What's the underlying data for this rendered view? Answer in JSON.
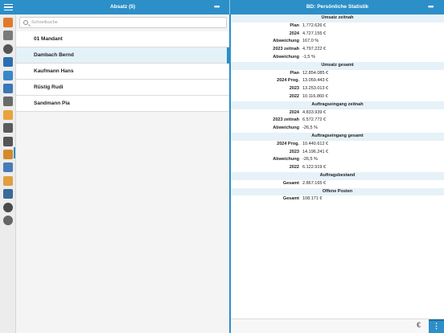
{
  "topbar": {
    "left_title": "Absatz  (5)",
    "right_title": "BD: Persönliche Statistik",
    "more_glyph": "•••"
  },
  "search": {
    "placeholder": "Schnellsuche"
  },
  "list": [
    {
      "label": "01 Mandant",
      "selected": false
    },
    {
      "label": "Dambach Bernd",
      "selected": true
    },
    {
      "label": "Kaufmann Hans",
      "selected": false
    },
    {
      "label": "Rüstig Rudi",
      "selected": false
    },
    {
      "label": "Sandmann Pia",
      "selected": false
    }
  ],
  "sidebar_icons": [
    "home-icon",
    "document-icon",
    "clock-icon",
    "people-icon",
    "chat-icon",
    "phone-icon",
    "building-icon",
    "folder-icon",
    "briefcase-icon",
    "euro-icon",
    "handshake-icon",
    "boxes-icon",
    "clipboard-icon",
    "link-icon",
    "target-icon",
    "gear-icon"
  ],
  "sections": [
    {
      "title": "Umsatz zeitnah",
      "rows": [
        {
          "k": "Plan",
          "v": "1.772.626 €"
        },
        {
          "k": "2024",
          "v": "4.727.155 €"
        },
        {
          "k": "Abweichung",
          "v": "167,0 %"
        },
        {
          "k": "2023 zeitnah",
          "v": "4.797.222 €"
        },
        {
          "k": "Abweichung",
          "v": "-1,5 %"
        }
      ]
    },
    {
      "title": "Umsatz gesamt",
      "rows": [
        {
          "k": "Plan",
          "v": "12.854.085 €"
        },
        {
          "k": "2024 Prog.",
          "v": "13.059.443 €"
        },
        {
          "k": "2023",
          "v": "13.253.013 €"
        },
        {
          "k": "2022",
          "v": "10.116.860 €"
        }
      ]
    },
    {
      "title": "Auftragseingang zeitnah",
      "rows": [
        {
          "k": "2024",
          "v": "4.833.939 €"
        },
        {
          "k": "2023 zeitnah",
          "v": "6.572.772 €"
        },
        {
          "k": "Abweichung",
          "v": "-26,5 %"
        }
      ]
    },
    {
      "title": "Auftragseingang gesamt",
      "rows": [
        {
          "k": "2024 Prog.",
          "v": "10.440.612 €"
        },
        {
          "k": "2023",
          "v": "14.196.241 €"
        },
        {
          "k": "Abweichung",
          "v": "-26,5 %"
        },
        {
          "k": "2022",
          "v": "6.122.919 €"
        }
      ]
    },
    {
      "title": "Auftragsbestand",
      "rows": [
        {
          "k": "Gesamt",
          "v": "2.867.165 €"
        }
      ]
    },
    {
      "title": "Offene Posten",
      "rows": [
        {
          "k": "Gesamt",
          "v": "108.171 €"
        }
      ]
    }
  ],
  "bottombar": {
    "currency_glyph": "€",
    "more_glyph": "⋮"
  },
  "colors": {
    "accent": "#2c8fc7",
    "section_bg": "#e6f1f8",
    "selected_row": "#e3f1f9"
  }
}
